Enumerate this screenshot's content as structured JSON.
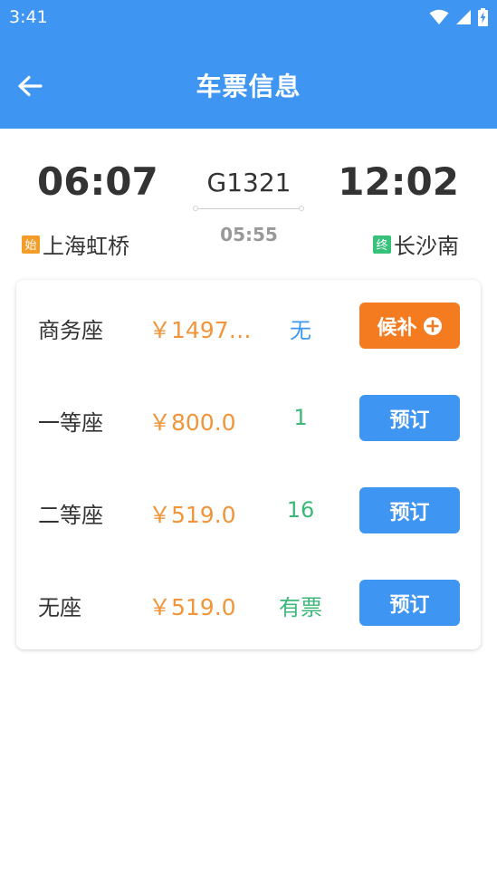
{
  "status_bar": {
    "time": "3:41"
  },
  "header": {
    "title": "车票信息"
  },
  "trip": {
    "departure_time": "06:07",
    "arrival_time": "12:02",
    "train_number": "G1321",
    "duration": "05:55",
    "from_tag": "始",
    "from_station": "上海虹桥",
    "to_tag": "终",
    "to_station": "长沙南"
  },
  "seats": [
    {
      "name": "商务座",
      "price": "￥1497…",
      "availability": "无",
      "button": "候补"
    },
    {
      "name": "一等座",
      "price": "￥800.0",
      "availability": "1",
      "button": "预订"
    },
    {
      "name": "二等座",
      "price": "￥519.0",
      "availability": "16",
      "button": "预订"
    },
    {
      "name": "无座",
      "price": "￥519.0",
      "availability": "有票",
      "button": "预订"
    }
  ],
  "colors": {
    "primary": "#3f96f2",
    "price": "#f0953a",
    "waitlist_button": "#f47b20",
    "available": "#3cb878",
    "unavailable": "#3f96f2",
    "from_tag": "#f39c29",
    "to_tag": "#38c17b"
  },
  "icons": {
    "back": "arrow-left-icon",
    "wifi": "wifi-icon",
    "signal": "cellular-signal-icon",
    "battery": "battery-charging-icon",
    "waitlist": "plus-circle-icon"
  }
}
